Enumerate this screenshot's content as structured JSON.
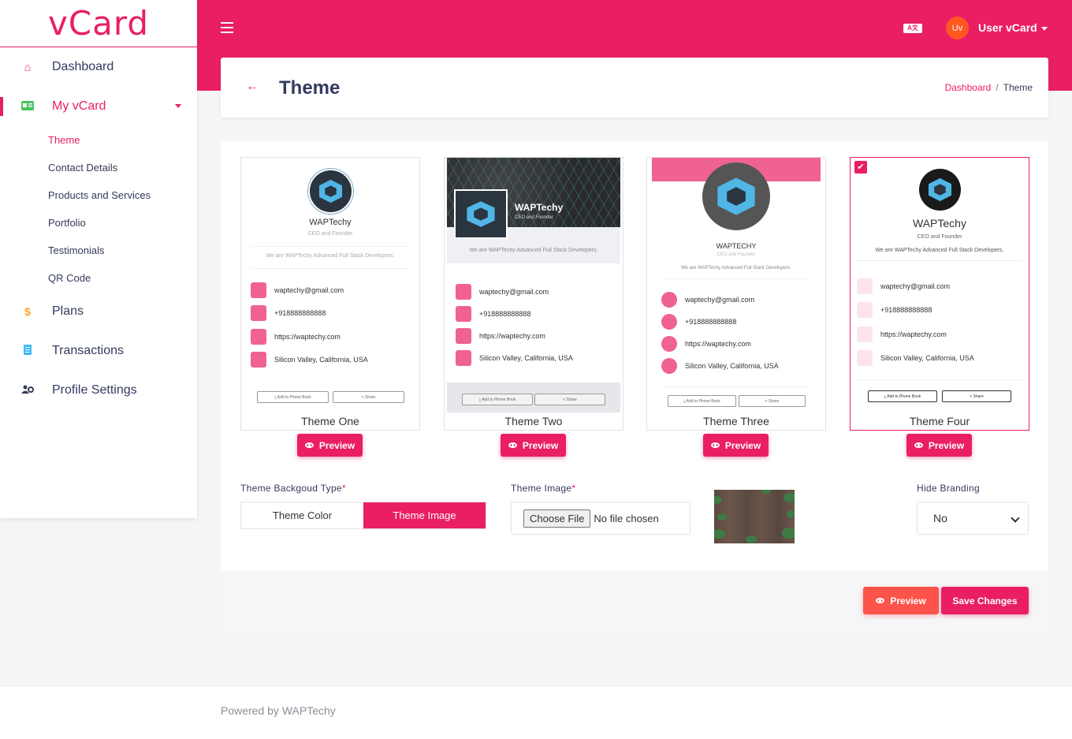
{
  "brand": "vCard",
  "nav": {
    "dashboard": "Dashboard",
    "myvcard": "My vCard",
    "sub": [
      "Theme",
      "Contact Details",
      "Products and Services",
      "Portfolio",
      "Testimonials",
      "QR Code"
    ],
    "plans": "Plans",
    "transactions": "Transactions",
    "profile": "Profile Settings"
  },
  "topbar": {
    "avatar_initials": "Uv",
    "user_name": "User vCard",
    "lang_icon": "A文"
  },
  "page": {
    "title": "Theme",
    "breadcrumb": [
      "Dashboard",
      "Theme"
    ]
  },
  "card": {
    "name": "WAPTechy",
    "name_upper": "WAPTECHY",
    "role": "CEO and Founder",
    "about": "We are WAPTechy Advanced Full Stack Developers.",
    "email": "waptechy@gmail.com",
    "phone": "+918888888888",
    "website": "https://waptechy.com",
    "address": "Silicon Valley, California, USA",
    "add_btn": "⤓ Add to Phone Book",
    "share_btn": "< Share"
  },
  "themes": [
    {
      "name": "Theme One",
      "selected": false
    },
    {
      "name": "Theme Two",
      "selected": false
    },
    {
      "name": "Theme Three",
      "selected": false
    },
    {
      "name": "Theme Four",
      "selected": true
    }
  ],
  "preview_label": "Preview",
  "form": {
    "bg_type_label": "Theme Backgoud Type",
    "bg_type_options": [
      "Theme Color",
      "Theme Image"
    ],
    "bg_type_selected": "Theme Image",
    "image_label": "Theme Image",
    "file_button": "Choose File",
    "file_status": "No file chosen",
    "hide_branding_label": "Hide Branding",
    "hide_branding_value": "No",
    "required_mark": "*"
  },
  "actions": {
    "preview": "Preview",
    "save": "Save Changes"
  },
  "footer": "Powered by WAPTechy",
  "colors": {
    "accent": "#e91e63",
    "orange": "#ff5722"
  }
}
